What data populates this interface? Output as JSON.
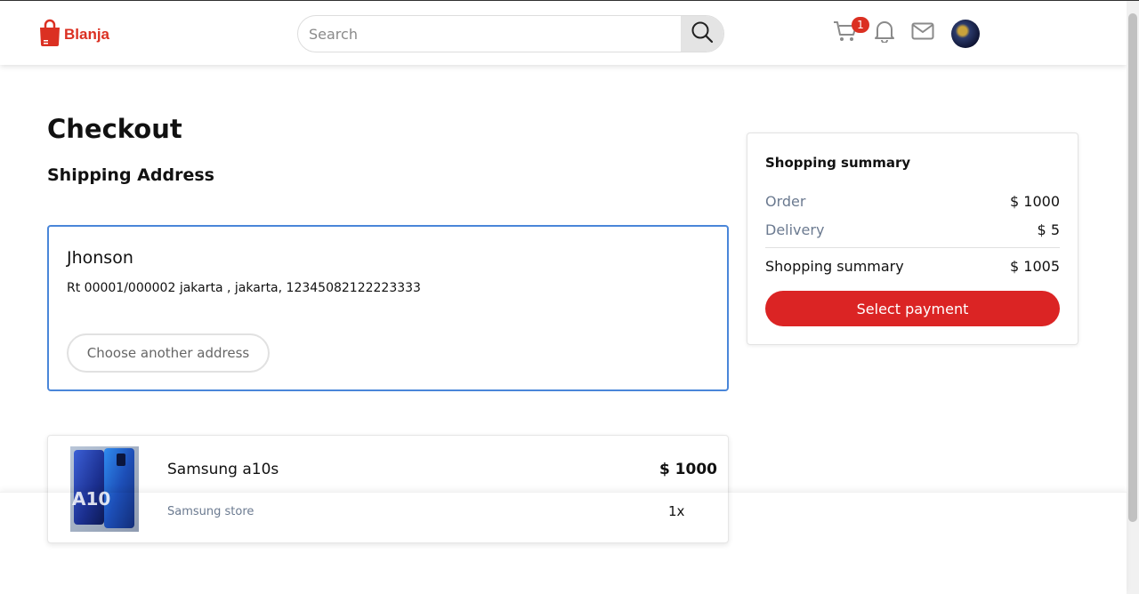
{
  "brand": {
    "name": "Blanja",
    "accent": "#db3022"
  },
  "header": {
    "search_placeholder": "Search",
    "cart_count": "1",
    "icons": [
      "cart-icon",
      "bell-icon",
      "mail-icon",
      "search-icon"
    ]
  },
  "checkout": {
    "title": "Checkout",
    "section_label": "Shipping Address",
    "address": {
      "name": "Jhonson",
      "line": "Rt 00001/000002 jakarta , jakarta, 12345082122223333",
      "change_label": "Choose another address"
    },
    "items": [
      {
        "name": "Samsung a10s",
        "store": "Samsung store",
        "price": "$ 1000",
        "qty": "1x"
      }
    ]
  },
  "summary": {
    "title": "Shopping summary",
    "order_label": "Order",
    "order_value": "$ 1000",
    "delivery_label": "Delivery",
    "delivery_value": "$ 5",
    "total_label": "Shopping summary",
    "total_value": "$ 1005",
    "pay_label": "Select payment"
  }
}
